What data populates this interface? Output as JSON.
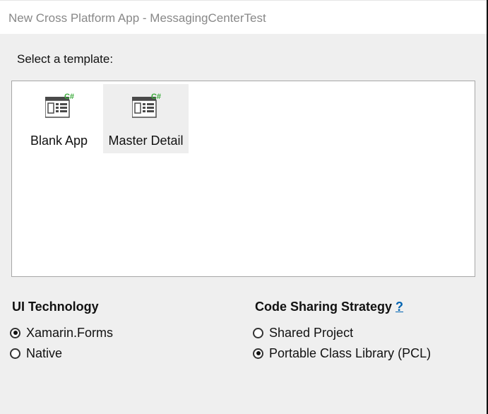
{
  "window": {
    "title": "New Cross Platform App - MessagingCenterTest"
  },
  "templates": {
    "prompt": "Select a template:",
    "items": [
      {
        "label": "Blank App",
        "icon": "xamarin-forms-template-icon",
        "selected": false
      },
      {
        "label": "Master Detail",
        "icon": "xamarin-forms-template-icon",
        "selected": true
      }
    ],
    "icon_badge": "C#"
  },
  "ui_technology": {
    "heading": "UI Technology",
    "options": [
      {
        "label": "Xamarin.Forms",
        "checked": true
      },
      {
        "label": "Native",
        "checked": false
      }
    ]
  },
  "code_sharing": {
    "heading": "Code Sharing Strategy",
    "help_link": "?",
    "options": [
      {
        "label": "Shared Project",
        "checked": false
      },
      {
        "label": "Portable Class Library (PCL)",
        "checked": true
      }
    ]
  },
  "colors": {
    "badge_green": "#3cab3c",
    "link_blue": "#0063b1",
    "window_bg": "#efefef"
  }
}
